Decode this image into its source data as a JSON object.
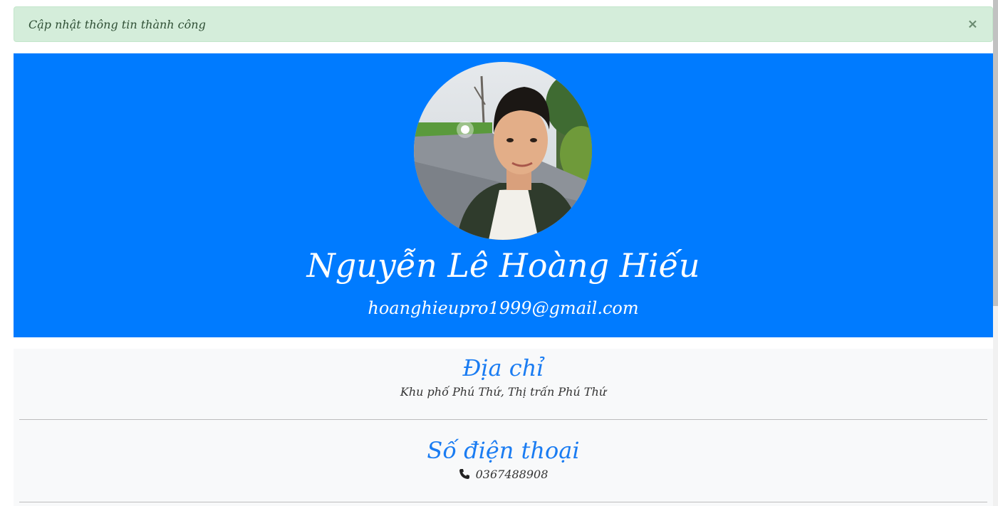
{
  "alert": {
    "message": "Cập nhật thông tin thành công",
    "close_label": "×",
    "background": "#d4edda"
  },
  "profile": {
    "name": "Nguyễn Lê Hoàng Hiếu",
    "email": "hoanghieupro1999@gmail.com",
    "hero_color": "#007bff",
    "avatar_icon": "profile-photo"
  },
  "address": {
    "heading": "Địa chỉ",
    "value": "Khu phố Phú Thứ, Thị trấn Phú Thứ"
  },
  "phone": {
    "heading": "Số điện thoại",
    "icon": "phone-icon",
    "value": "0367488908"
  },
  "colors": {
    "accent": "#1a7cf2",
    "panel": "#f8f9fa"
  }
}
